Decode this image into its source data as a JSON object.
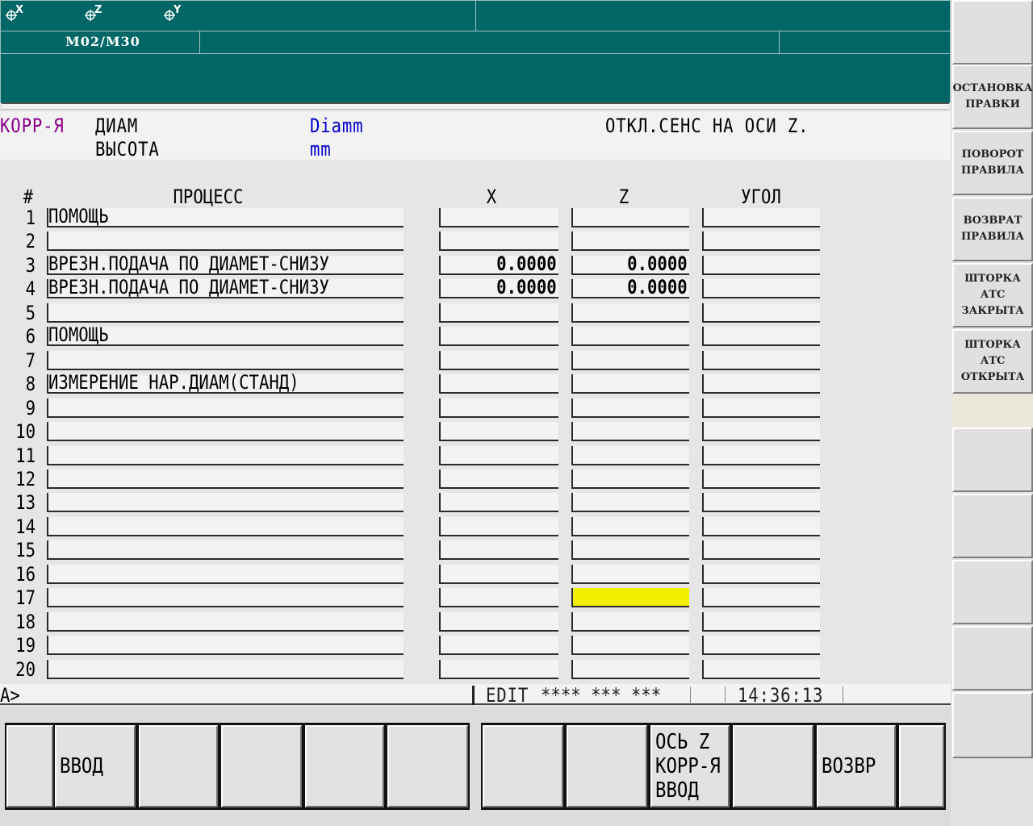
{
  "header": {
    "axes": [
      "X",
      "Z",
      "Y"
    ],
    "mcode": "M02/M30"
  },
  "info": {
    "mode": "КОРР-Я",
    "labels": [
      "ДИАМ",
      "ВЫСОТА"
    ],
    "values": [
      "Diamm",
      "mm"
    ],
    "message": "ОТКЛ.СЕНС НА ОСИ Z."
  },
  "table": {
    "columns": {
      "num": "#",
      "process": "ПРОЦЕСС",
      "x": "X",
      "z": "Z",
      "angle": "УГОЛ"
    },
    "rows": [
      {
        "n": "1",
        "process": "ПОМОЩЬ",
        "x": "",
        "z": "",
        "angle": ""
      },
      {
        "n": "2",
        "process": "",
        "x": "",
        "z": "",
        "angle": ""
      },
      {
        "n": "3",
        "process": "ВРЕЗН.ПОДАЧА ПО ДИАМЕТ-СНИЗУ",
        "x": "0.0000",
        "z": "0.0000",
        "angle": ""
      },
      {
        "n": "4",
        "process": "ВРЕЗН.ПОДАЧА ПО ДИАМЕТ-СНИЗУ",
        "x": "0.0000",
        "z": "0.0000",
        "angle": ""
      },
      {
        "n": "5",
        "process": "",
        "x": "",
        "z": "",
        "angle": ""
      },
      {
        "n": "6",
        "process": "ПОМОЩЬ",
        "x": "",
        "z": "",
        "angle": ""
      },
      {
        "n": "7",
        "process": "",
        "x": "",
        "z": "",
        "angle": ""
      },
      {
        "n": "8",
        "process": "ИЗМЕРЕНИЕ НАР.ДИАМ(СТАНД)",
        "x": "",
        "z": "",
        "angle": ""
      },
      {
        "n": "9",
        "process": "",
        "x": "",
        "z": "",
        "angle": ""
      },
      {
        "n": "10",
        "process": "",
        "x": "",
        "z": "",
        "angle": ""
      },
      {
        "n": "11",
        "process": "",
        "x": "",
        "z": "",
        "angle": ""
      },
      {
        "n": "12",
        "process": "",
        "x": "",
        "z": "",
        "angle": ""
      },
      {
        "n": "13",
        "process": "",
        "x": "",
        "z": "",
        "angle": ""
      },
      {
        "n": "14",
        "process": "",
        "x": "",
        "z": "",
        "angle": ""
      },
      {
        "n": "15",
        "process": "",
        "x": "",
        "z": "",
        "angle": ""
      },
      {
        "n": "16",
        "process": "",
        "x": "",
        "z": "",
        "angle": ""
      },
      {
        "n": "17",
        "process": "",
        "x": "",
        "z": "",
        "angle": ""
      },
      {
        "n": "18",
        "process": "",
        "x": "",
        "z": "",
        "angle": ""
      },
      {
        "n": "19",
        "process": "",
        "x": "",
        "z": "",
        "angle": ""
      },
      {
        "n": "20",
        "process": "",
        "x": "",
        "z": "",
        "angle": ""
      }
    ],
    "selected": {
      "row": 17,
      "column": "z"
    }
  },
  "status": {
    "prompt": "A>",
    "mode": "EDIT",
    "fields": "**** *** ***",
    "time": "14:36:13"
  },
  "softkeys": {
    "bottom": [
      "",
      "ВВОД",
      "",
      "",
      "",
      "",
      "",
      "",
      "ОСЬ Z\nКОРР-Я\nВВОД",
      "",
      "ВОЗВР",
      ""
    ],
    "right": [
      "",
      "ОСТАНОВКА\nПРАВКИ",
      "ПОВОРОТ\nПРАВИЛА",
      "ВОЗВРАТ\nПРАВИЛА",
      "ШТОРКА\nАТС\nЗАКРЫТА",
      "ШТОРКА\nАТС\nОТКРЫТА",
      "",
      "",
      "",
      "",
      ""
    ]
  },
  "colors": {
    "header_bg": "#006666",
    "mode_text": "#8a008a",
    "value_text": "#0000cc",
    "highlight": "#f0f000"
  }
}
